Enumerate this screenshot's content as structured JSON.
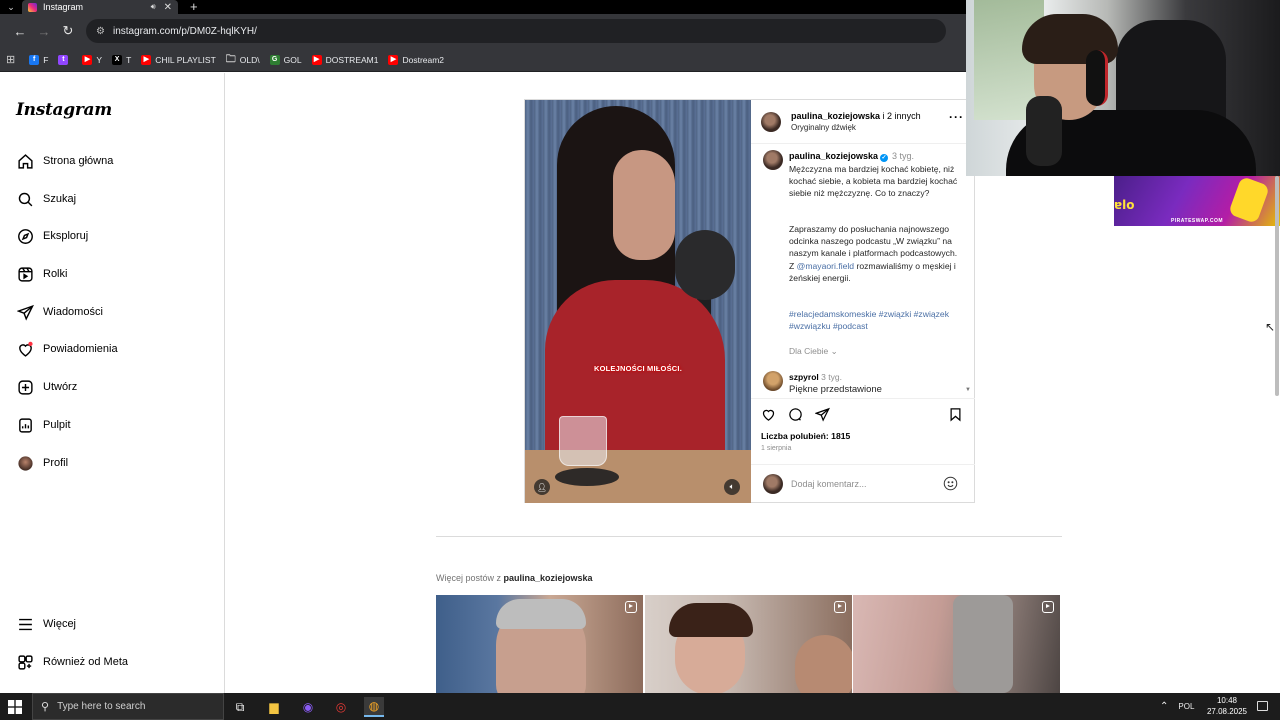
{
  "browser": {
    "tab": {
      "title": "Instagram"
    },
    "url": "instagram.com/p/DM0Z-hqlKYH/",
    "bookmarks": [
      {
        "label": "F",
        "color": "#1877f2",
        "glyph": "f"
      },
      {
        "label": "",
        "color": "#9146ff",
        "glyph": "t"
      },
      {
        "label": "Y",
        "color": "#ff0000",
        "glyph": "▶"
      },
      {
        "label": "T",
        "color": "#000000",
        "glyph": "X"
      },
      {
        "label": "CHIL PLAYLIST",
        "color": "#ff0000",
        "glyph": "▶"
      },
      {
        "label": "OLD\\",
        "color": "",
        "glyph": "folder"
      },
      {
        "label": "GOL",
        "color": "#2e7d32",
        "glyph": "G"
      },
      {
        "label": "DOSTREAM1",
        "color": "#ff0000",
        "glyph": "▶"
      },
      {
        "label": "Dostream2",
        "color": "#ff0000",
        "glyph": "▶"
      }
    ]
  },
  "instagram": {
    "logo": "Instagram",
    "nav": [
      {
        "label": "Strona główna",
        "icon": "home-icon"
      },
      {
        "label": "Szukaj",
        "icon": "search-icon"
      },
      {
        "label": "Eksploruj",
        "icon": "compass-icon"
      },
      {
        "label": "Rolki",
        "icon": "reels-icon"
      },
      {
        "label": "Wiadomości",
        "icon": "messages-icon"
      },
      {
        "label": "Powiadomienia",
        "icon": "heart-icon"
      },
      {
        "label": "Utwórz",
        "icon": "create-icon"
      },
      {
        "label": "Pulpit",
        "icon": "dashboard-icon"
      },
      {
        "label": "Profil",
        "icon": "profile-avatar"
      }
    ],
    "bottom_nav": [
      {
        "label": "Więcej",
        "icon": "menu-icon"
      },
      {
        "label": "Również od Meta",
        "icon": "meta-icon"
      }
    ]
  },
  "post": {
    "header_user": "paulina_koziejowska",
    "header_and": " i 2 innych",
    "audio": "Oryginalny dźwięk",
    "video_caption": "KOLEJNOŚCI MIŁOŚCI.",
    "caption_user": "paulina_koziejowska",
    "caption_time": "3 tyg.",
    "caption_p1": "Mężczyzna ma bardziej kochać kobietę, niż kochać siebie, a kobieta ma bardziej kochać siebie niż mężczyznę. Co to znaczy?",
    "caption_p2a": "Zapraszamy do posłuchania najnowszego odcinka naszego podcastu „W związku” na naszym kanale i platformach podcastowych. Z ",
    "caption_mention": "@mayaori.field",
    "caption_p2b": " rozmawialiśmy o męskiej i żeńskiej energii.",
    "hashtags": "#relacjedamskomeskie #związki #związek #wzwiązku #podcast",
    "for_you": "Dla Ciebie",
    "comment_user": "szpyrol",
    "comment_time": "3 tyg.",
    "comment_text": "Piękne przedstawione",
    "likes": "Liczba polubień: 1815",
    "date": "1 sierpnia",
    "add_comment_placeholder": "Dodaj komentarz..."
  },
  "more_posts": {
    "prefix": "Więcej postów z ",
    "user": "paulina_koziejowska"
  },
  "overlay": {
    "banner_text": "PIRATESWAP.COM"
  },
  "taskbar": {
    "search_placeholder": "Type here to search",
    "language": "POL",
    "time": "10:48",
    "date": "27.08.2025"
  }
}
